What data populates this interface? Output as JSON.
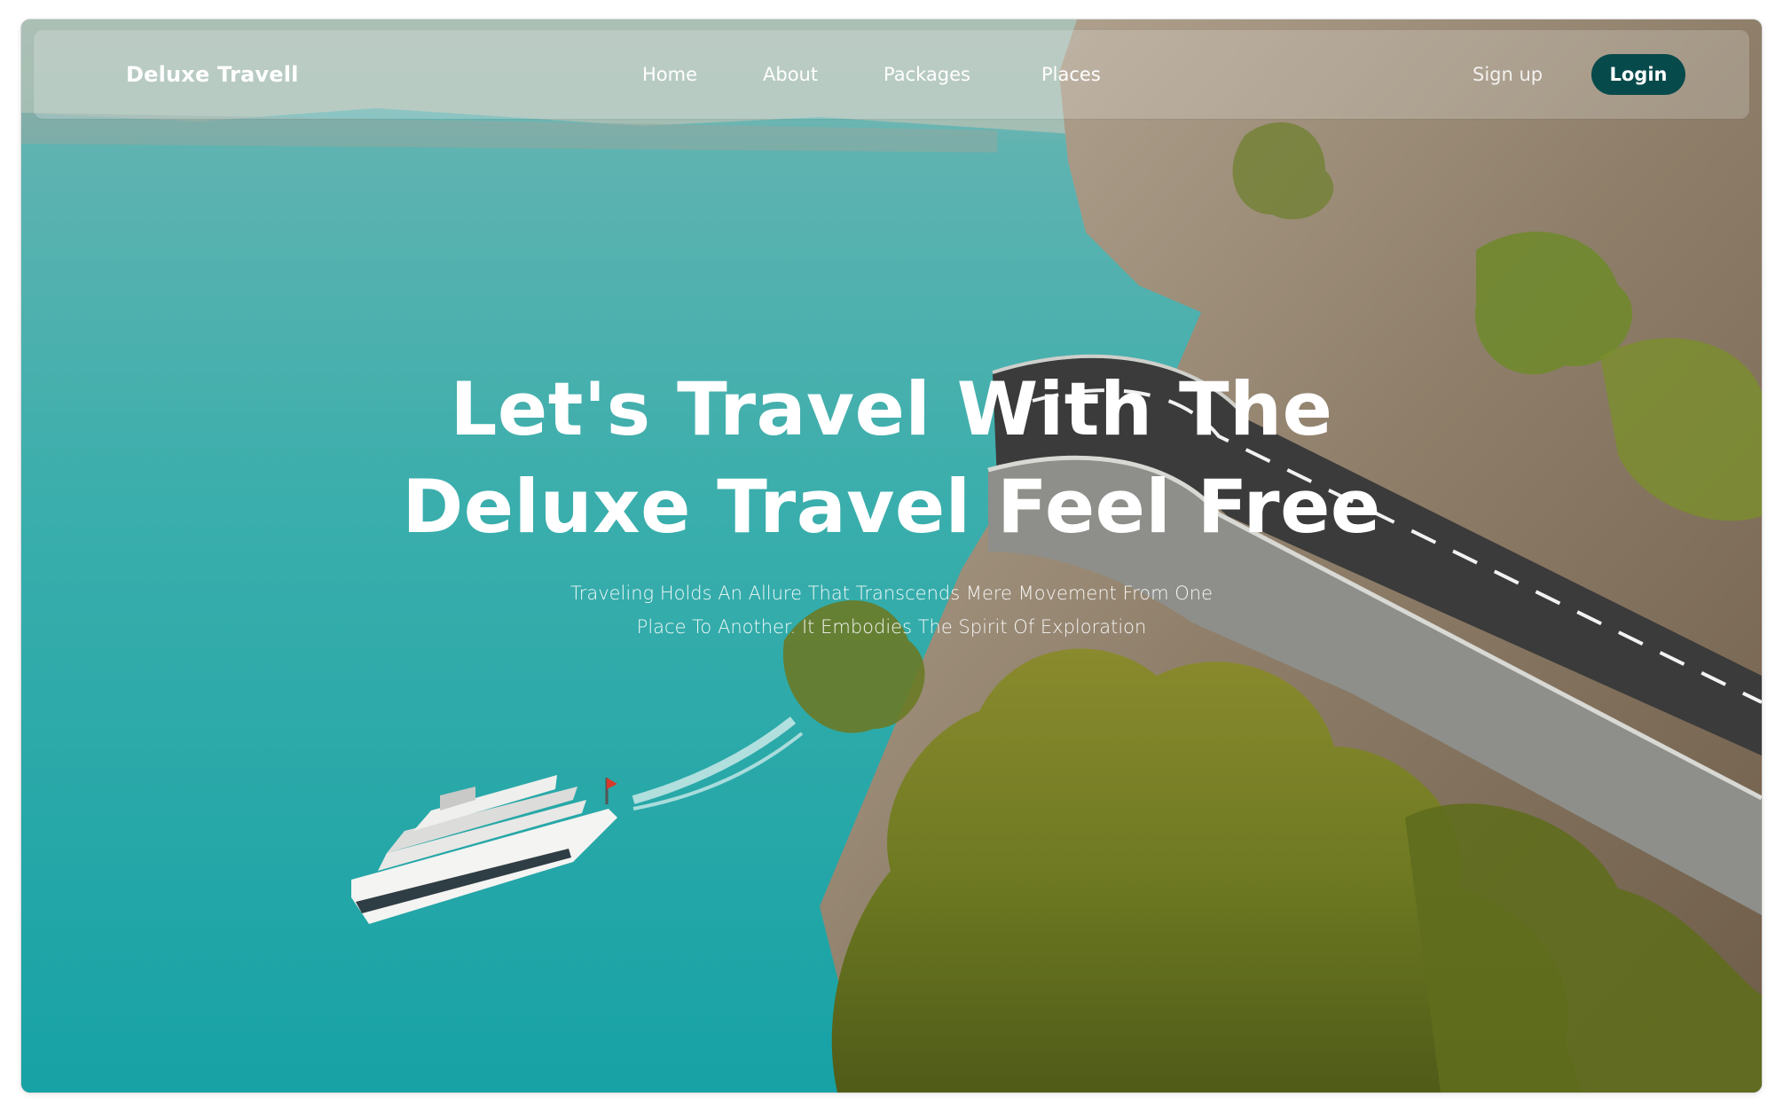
{
  "nav": {
    "brand": "Deluxe Travell",
    "links": [
      "Home",
      "About",
      "Packages",
      "Places"
    ],
    "signup_label": "Sign up",
    "login_label": "Login"
  },
  "hero": {
    "headline_line1": "Let's Travel With The",
    "headline_line2": "Deluxe Travel Feel Free",
    "subtitle_line1": "Traveling Holds An Allure That Transcends Mere Movement From One",
    "subtitle_line2": "Place To Another. It Embodies The Spirit Of Exploration"
  },
  "colors": {
    "login_button_bg": "#074a4b",
    "lake": "#2fa7a6",
    "text": "#ffffff"
  }
}
